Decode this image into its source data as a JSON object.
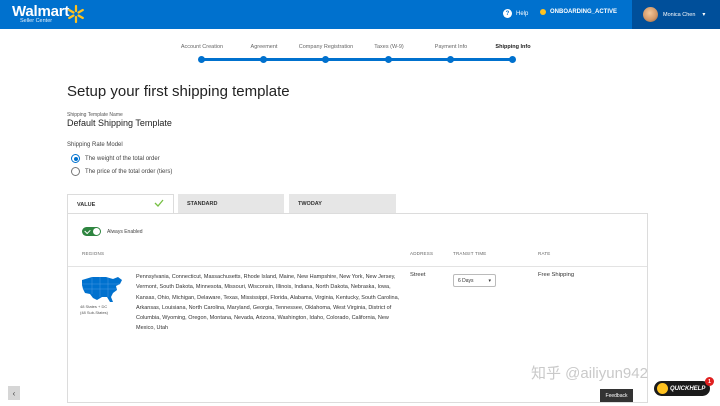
{
  "header": {
    "brand": "Walmart",
    "brand_sub": "Seller Center",
    "help": "Help",
    "status": "ONBOARDING_ACTIVE",
    "user_name": "Monica Chen",
    "colors": {
      "primary": "#0071ce",
      "accent": "#ffc220",
      "dark": "#004f9a"
    }
  },
  "stepper": {
    "steps": [
      {
        "label": "Account Creation"
      },
      {
        "label": "Agreement"
      },
      {
        "label": "Company Registration"
      },
      {
        "label": "Taxes (W-9)"
      },
      {
        "label": "Payment Info"
      },
      {
        "label": "Shipping Info"
      }
    ],
    "active_step": "Shipping Info"
  },
  "main": {
    "title": "Setup your first shipping template",
    "template_name_label": "Shipping Template Name",
    "template_name": "Default Shipping Template",
    "rate_model_label": "Shipping Rate Model",
    "rate_options": [
      {
        "label": "The weight of the total order",
        "selected": true
      },
      {
        "label": "The price of the total order (tiers)",
        "selected": false
      }
    ]
  },
  "tabs": [
    {
      "label": "VALUE",
      "active": true
    },
    {
      "label": "STANDARD",
      "active": false
    },
    {
      "label": "TWODAY",
      "active": false
    }
  ],
  "panel": {
    "toggle_label": "Always Enabled",
    "toggle_on": true,
    "headers": {
      "regions": "REGIONS",
      "address": "ADDRESS",
      "transit": "TRANSIT TIME",
      "rate": "RATE"
    },
    "row": {
      "map_caption_1": "48 States + DC",
      "map_caption_2": "(48 Sub-States)",
      "states": "Pennsylvania, Connecticut, Massachusetts, Rhode Island, Maine, New Hampshire, New York, New Jersey, Vermont, South Dakota, Minnesota, Missouri, Wisconsin, Illinois, Indiana, North Dakota, Nebraska, Iowa, Kansas, Ohio, Michigan, Delaware, Texas, Mississippi, Florida, Alabama, Virginia, Kentucky, South Carolina, Arkansas, Louisiana, North Carolina, Maryland, Georgia, Tennessee, Oklahoma, West Virginia, District of Columbia, Wyoming, Oregon, Montana, Nevada, Arizona, Washington, Idaho, Colorado, California, New Mexico, Utah",
      "address": "Street",
      "transit_value": "6 Days",
      "rate": "Free Shipping"
    }
  },
  "footer": {
    "feedback": "Feedback",
    "quickhelp": "QUICKHELP",
    "quickhelp_badge": "1",
    "watermark": "知乎 @ailiyun942"
  }
}
